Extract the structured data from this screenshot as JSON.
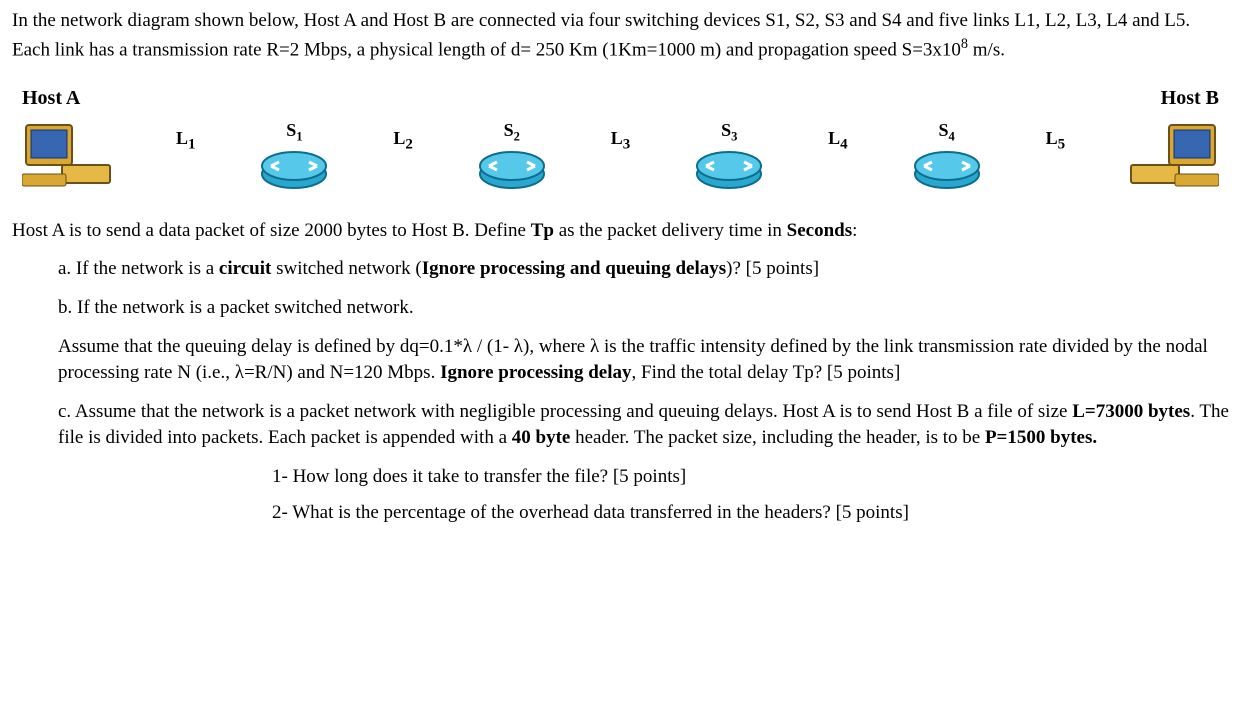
{
  "intro": {
    "line1_before": "In the network diagram shown below, Host A and Host B are connected via four switching devices S1, S2, S3 and S4 and five links L1, L2, L3, L4 and L5. Each link has a transmission rate R=2 Mbps, a physical length of d= 250 Km (1Km=1000 m) and propagation speed S=3x10",
    "line1_exp": "8",
    "line1_after": " m/s."
  },
  "diagram": {
    "hostA": "Host A",
    "hostB": "Host B",
    "links": {
      "l1": "L",
      "l1s": "1",
      "l2": "L",
      "l2s": "2",
      "l3": "L",
      "l3s": "3",
      "l4": "L",
      "l4s": "4",
      "l5": "L",
      "l5s": "5"
    },
    "switches": {
      "s1": "S",
      "s1s": "1",
      "s2": "S",
      "s2s": "2",
      "s3": "S",
      "s3s": "3",
      "s4": "S",
      "s4s": "4"
    }
  },
  "q": {
    "lead_pre": "Host A is to send a data packet of size 2000 bytes to Host B. Define ",
    "lead_tp": "Tp",
    "lead_mid": " as the packet delivery time in ",
    "lead_sec": "Seconds",
    "lead_post": ":",
    "a_pre": "a. If the network is a ",
    "a_bold": "circuit",
    "a_mid": " switched network (",
    "a_bold2": "Ignore processing and queuing delays",
    "a_post": ")? [5 points]",
    "b": "b. If the network is a packet switched network.",
    "bdetail_pre": "Assume that the queuing delay is defined by dq=0.1*λ / (1- λ), where λ is the traffic intensity defined by the link transmission rate divided by the nodal processing rate N (i.e., λ=R/N) and N=120 Mbps. ",
    "bdetail_bold": "Ignore processing delay",
    "bdetail_post": ", Find the total delay Tp? [5 points]",
    "c_pre": "c. Assume that the network is a packet network with negligible processing and queuing delays. Host A is to send Host B a file of size ",
    "c_b1": "L=73000 bytes",
    "c_mid1": ". The file is divided into packets. Each packet is appended with a ",
    "c_b2": "40 byte",
    "c_mid2": " header. The packet size, including the header, is to be ",
    "c_b3": "P=1500 bytes.",
    "c1": "1- How long does it take to transfer the file? [5 points]",
    "c2": "2- What is the percentage of the overhead data transferred in the headers? [5 points]"
  }
}
